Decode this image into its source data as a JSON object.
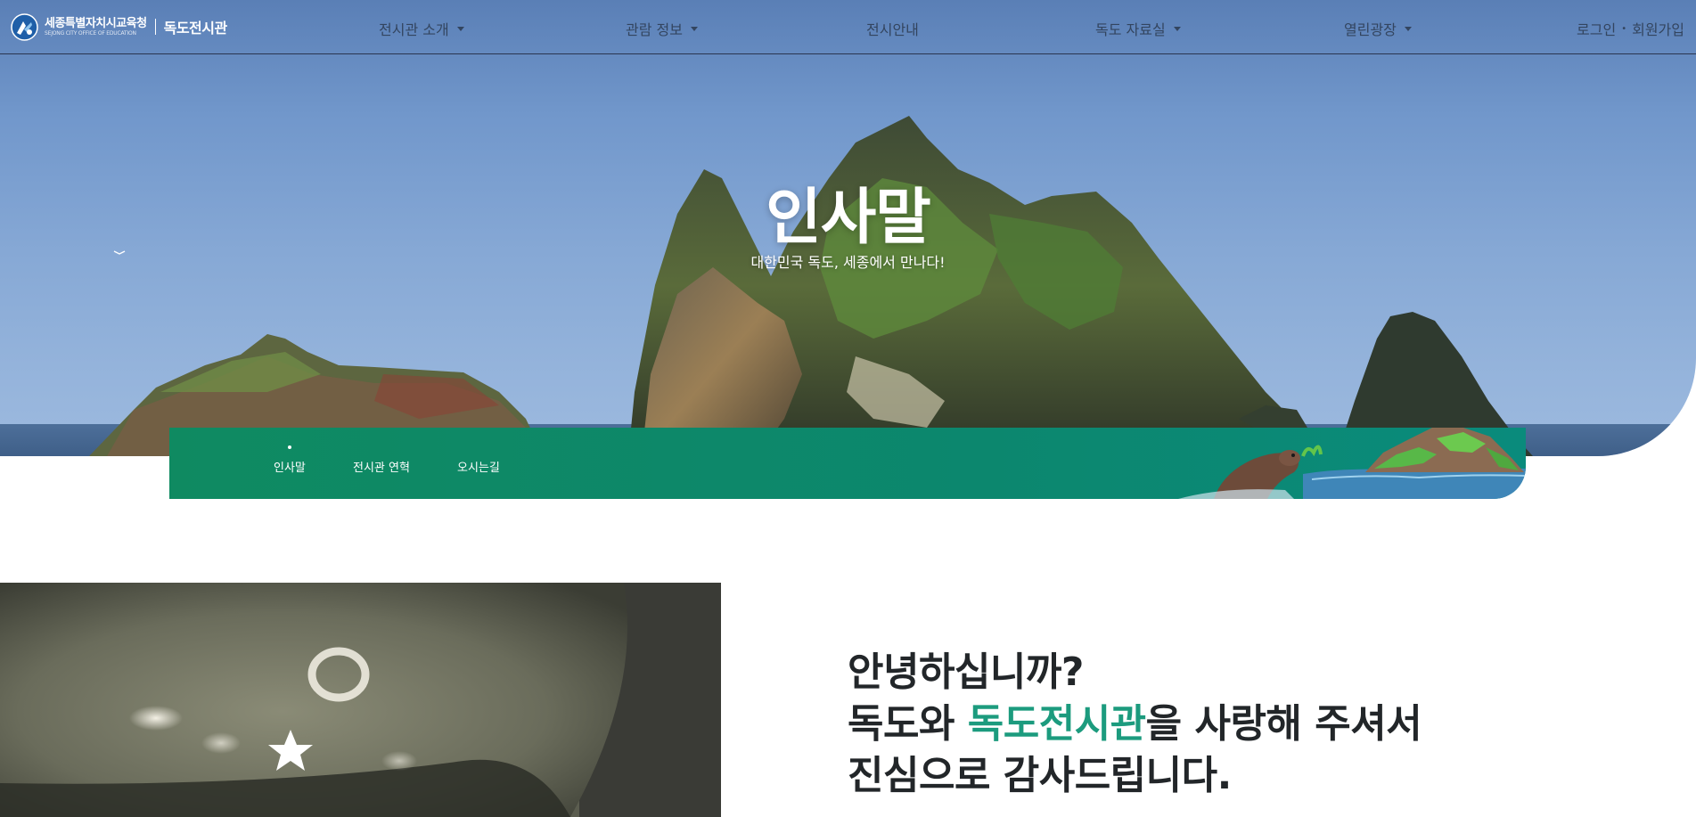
{
  "header": {
    "logo": {
      "emblem": "sejong-office-emblem",
      "office_name_ko": "세종특별자치시교육청",
      "office_name_en": "SEJONG CITY OFFICE OF EDUCATION",
      "site_name": "독도전시관"
    },
    "menu": [
      {
        "label": "전시관 소개",
        "has_dropdown": true
      },
      {
        "label": "관람 정보",
        "has_dropdown": true
      },
      {
        "label": "전시안내",
        "has_dropdown": false
      },
      {
        "label": "독도 자료실",
        "has_dropdown": true
      },
      {
        "label": "열린광장",
        "has_dropdown": true
      }
    ],
    "auth": {
      "login": "로그인",
      "separator": "•",
      "signup": "회원가입"
    }
  },
  "hero": {
    "title": "인사말",
    "subtitle": "대한민국 독도, 세종에서 만나다!"
  },
  "subnav": {
    "items": [
      {
        "label": "인사말",
        "active": true
      },
      {
        "label": "전시관 연혁",
        "active": false
      },
      {
        "label": "오시는길",
        "active": false
      }
    ]
  },
  "greeting": {
    "line1": "안녕하십니까?",
    "line2_pre": "독도와 ",
    "line2_highlight": "독도전시관",
    "line2_post": "을 사랑해 주셔서",
    "line3": "진심으로 감사드립니다."
  },
  "colors": {
    "nav_text": "#33455f",
    "subnav_green": "#0d8968",
    "highlight": "#1c9b7e",
    "heading_text": "#222629"
  }
}
